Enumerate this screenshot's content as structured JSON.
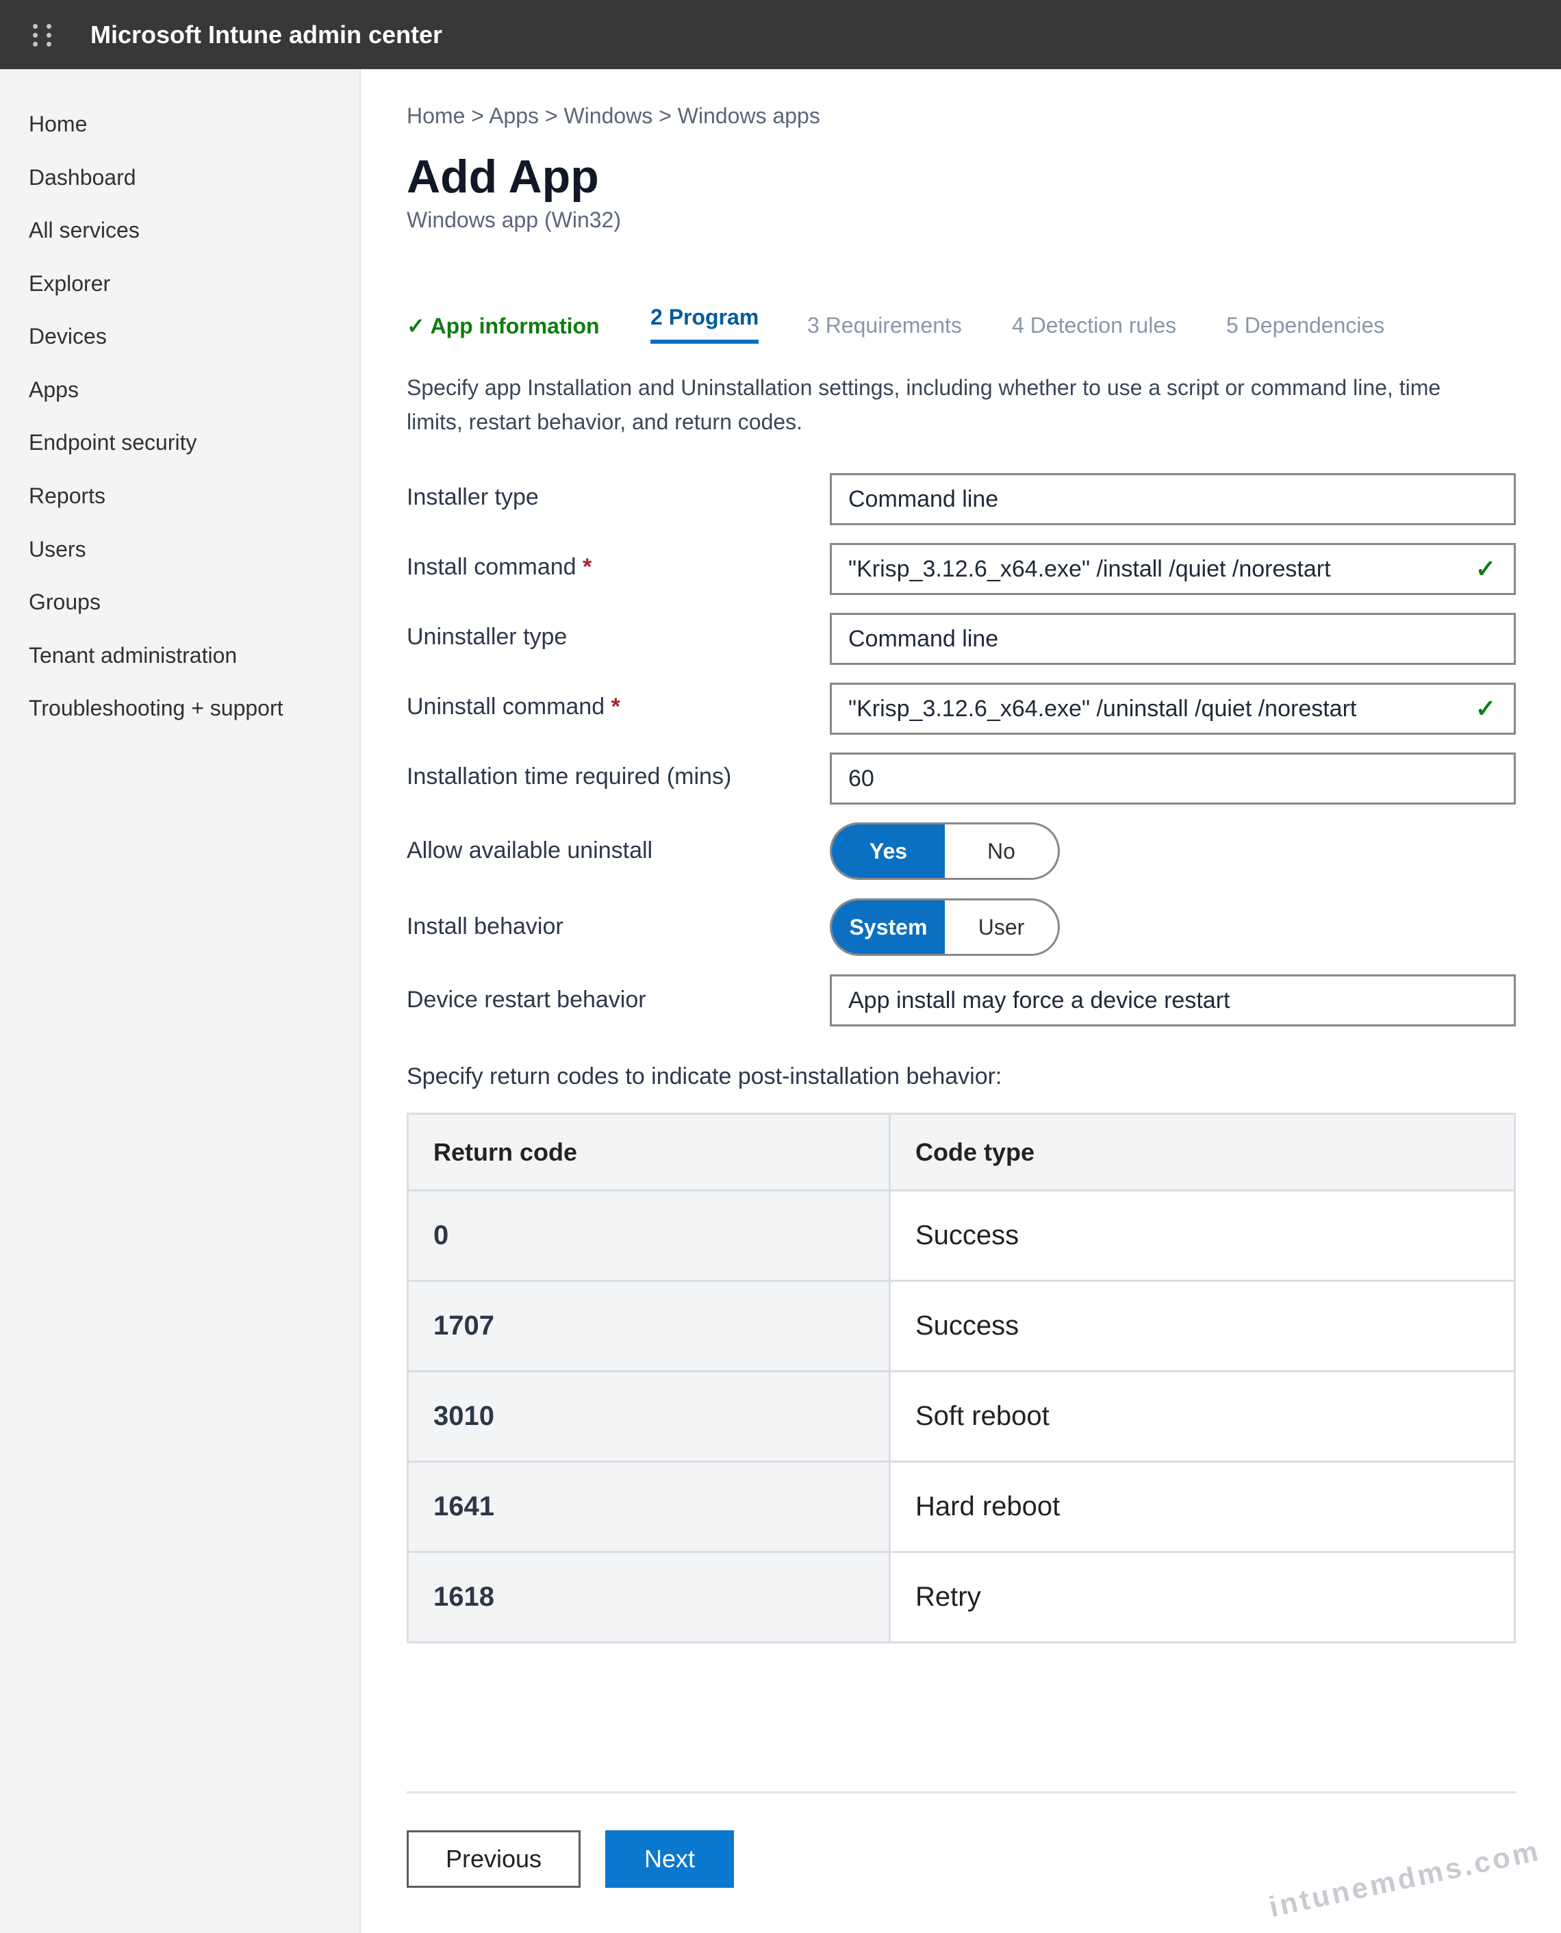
{
  "header": {
    "title": "Microsoft Intune admin center"
  },
  "sidebar": {
    "items": [
      {
        "label": "Home"
      },
      {
        "label": "Dashboard"
      },
      {
        "label": "All services"
      },
      {
        "label": "Explorer"
      },
      {
        "label": "Devices"
      },
      {
        "label": "Apps"
      },
      {
        "label": "Endpoint security"
      },
      {
        "label": "Reports"
      },
      {
        "label": "Users"
      },
      {
        "label": "Groups"
      },
      {
        "label": "Tenant administration"
      },
      {
        "label": "Troubleshooting + support"
      }
    ]
  },
  "breadcrumb": "Home > Apps > Windows > Windows apps",
  "page": {
    "title": "Add App",
    "subtitle": "Windows app (Win32)"
  },
  "tabs": [
    {
      "label": "✓ App information",
      "state": "done"
    },
    {
      "label": "2 Program",
      "state": "active"
    },
    {
      "label": "3 Requirements",
      "state": "future"
    },
    {
      "label": "4 Detection rules",
      "state": "future"
    },
    {
      "label": "5 Dependencies",
      "state": "future"
    }
  ],
  "description": "Specify app Installation and Uninstallation settings, including whether to use a script or command line, time limits, restart behavior, and return codes.",
  "form": {
    "installer_type": {
      "label": "Installer type",
      "value": "Command line"
    },
    "install_command": {
      "label": "Install command",
      "required": "*",
      "value": "\"Krisp_3.12.6_x64.exe\" /install /quiet /norestart",
      "check": "✓"
    },
    "uninstaller_type": {
      "label": "Uninstaller type",
      "value": "Command line"
    },
    "uninstall_command": {
      "label": "Uninstall command",
      "required": "*",
      "value": "\"Krisp_3.12.6_x64.exe\" /uninstall /quiet /norestart",
      "check": "✓"
    },
    "install_time": {
      "label": "Installation time required (mins)",
      "value": "60"
    },
    "allow_uninstall": {
      "label": "Allow available uninstall",
      "options": [
        "Yes",
        "No"
      ],
      "selected": "Yes"
    },
    "install_behavior": {
      "label": "Install behavior",
      "options": [
        "System",
        "User"
      ],
      "selected": "System"
    },
    "restart_behavior": {
      "label": "Device restart behavior",
      "value": "App install may force a device restart"
    }
  },
  "return_codes": {
    "intro": "Specify return codes to indicate post-installation behavior:",
    "headers": [
      "Return code",
      "Code type"
    ],
    "rows": [
      {
        "code": "0",
        "type": "Success"
      },
      {
        "code": "1707",
        "type": "Success"
      },
      {
        "code": "3010",
        "type": "Soft reboot"
      },
      {
        "code": "1641",
        "type": "Hard reboot"
      },
      {
        "code": "1618",
        "type": "Retry"
      }
    ]
  },
  "buttons": {
    "previous": "Previous",
    "next": "Next"
  },
  "watermark": "intunemdms.com",
  "colors": {
    "topbar": "#3a3836",
    "accent": "#0b6fc2",
    "success": "#107c10",
    "required": "#a4262c"
  },
  "icons": {
    "app_launcher": "waffle-icon",
    "valid": "checkmark-icon"
  }
}
